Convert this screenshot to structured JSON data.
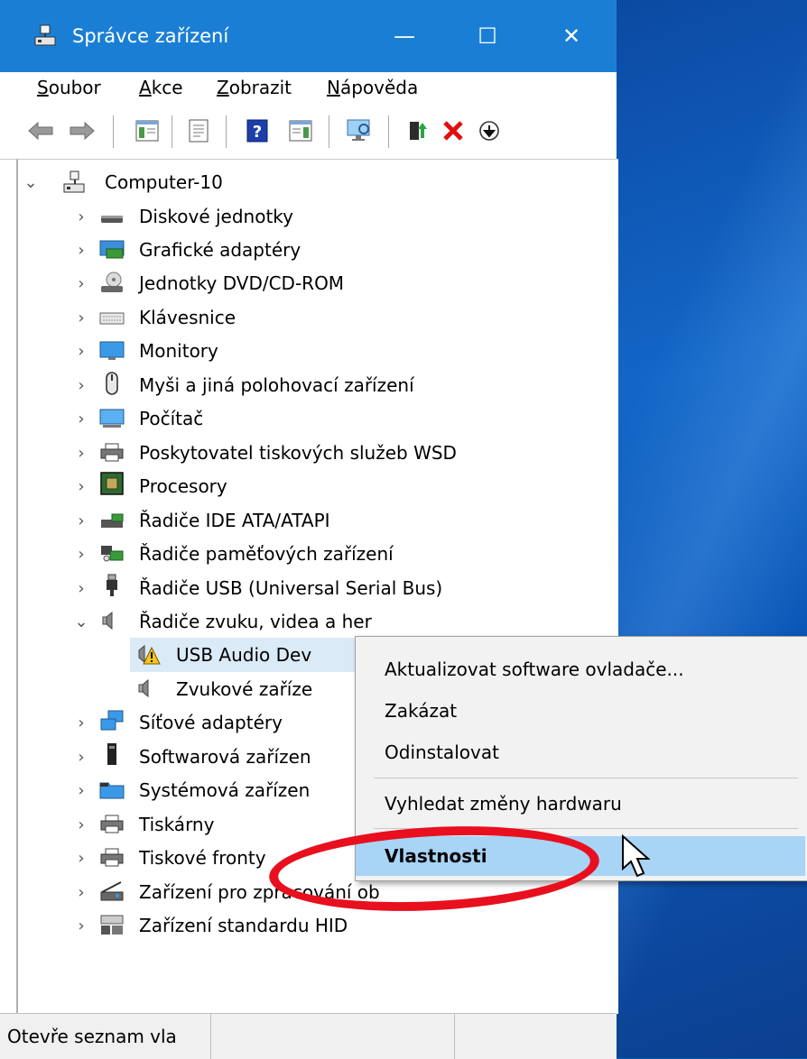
{
  "window": {
    "title": "Správce zařízení",
    "minimize": "—",
    "maximize": "☐",
    "close": "✕"
  },
  "menu": {
    "file": {
      "accel": "S",
      "rest": "oubor"
    },
    "action": {
      "accel": "A",
      "rest": "kce"
    },
    "view": {
      "accel": "Z",
      "rest": "obrazit"
    },
    "help": {
      "accel": "N",
      "rest": "ápověda"
    }
  },
  "tree": {
    "root": "Computer-10",
    "items": [
      "Diskové jednotky",
      "Grafické adaptéry",
      "Jednotky DVD/CD-ROM",
      "Klávesnice",
      "Monitory",
      "Myši a jiná polohovací zařízení",
      "Počítač",
      "Poskytovatel tiskových služeb WSD",
      "Procesory",
      "Řadiče IDE ATA/ATAPI",
      "Řadiče paměťových zařízení",
      "Řadiče USB (Universal Serial Bus)",
      "Řadiče zvuku, videa a her",
      "USB Audio Dev",
      "Zvukové zaříze",
      "Síťové adaptéry",
      "Softwarová zařízen",
      "Systémová zařízen",
      "Tiskárny",
      "Tiskové fronty",
      "Zařízení pro zpracování ob",
      "Zařízení standardu HID"
    ]
  },
  "context_menu": {
    "update": "Aktualizovat software ovladače...",
    "disable": "Zakázat",
    "uninstall": "Odinstalovat",
    "scan": "Vyhledat změny hardwaru",
    "properties": "Vlastnosti"
  },
  "status": {
    "text": "Otevře seznam vla"
  },
  "colors": {
    "titlebar": "#1a7fd4",
    "highlight": "#a8d4f6",
    "annotation": "#e8101e"
  }
}
